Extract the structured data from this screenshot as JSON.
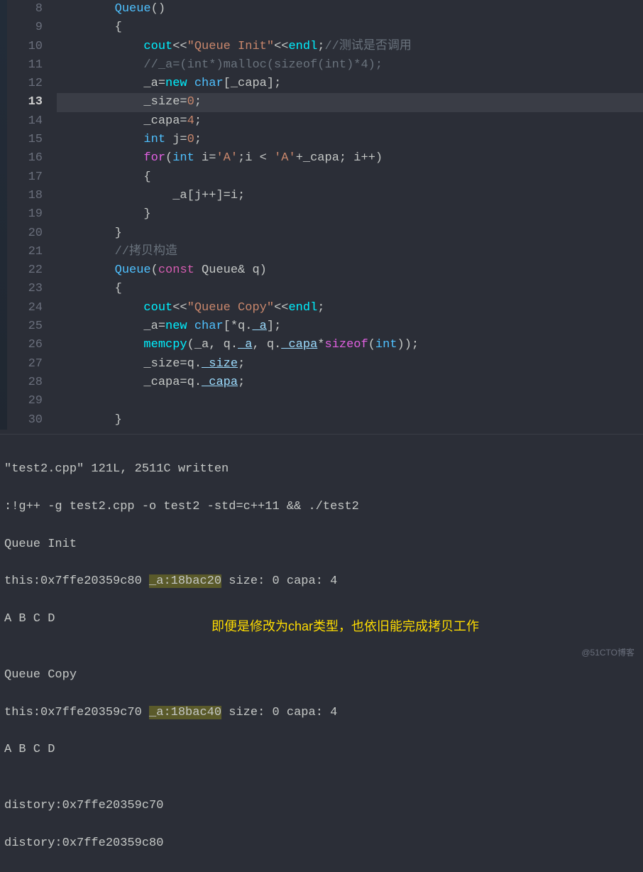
{
  "line_numbers": [
    "8",
    "9",
    "10",
    "11",
    "12",
    "13",
    "14",
    "15",
    "16",
    "17",
    "18",
    "19",
    "20",
    "21",
    "22",
    "23",
    "24",
    "25",
    "26",
    "27",
    "28",
    "29",
    "30"
  ],
  "current_line_index": 5,
  "code": {
    "l8": {
      "indent": "        ",
      "t1": "Queue",
      "t2": "()"
    },
    "l9": {
      "indent": "        ",
      "t1": "{"
    },
    "l10": {
      "indent": "            ",
      "t1": "cout",
      "t2": "<<",
      "t3": "\"Queue Init\"",
      "t4": "<<",
      "t5": "endl",
      "t6": ";",
      "t7": "//测试是否调用"
    },
    "l11": {
      "indent": "            ",
      "t1": "//_a=(int*)malloc(sizeof(int)*4);"
    },
    "l12": {
      "indent": "            ",
      "t1": "_a=",
      "t2": "new",
      "t3": " ",
      "t4": "char",
      "t5": "[_capa];"
    },
    "l13": {
      "indent": "            ",
      "t1": "_size=",
      "t2": "0",
      "t3": ";"
    },
    "l14": {
      "indent": "            ",
      "t1": "_capa=",
      "t2": "4",
      "t3": ";"
    },
    "l15": {
      "indent": "            ",
      "t1": "int",
      "t2": " j=",
      "t3": "0",
      "t4": ";"
    },
    "l16": {
      "indent": "            ",
      "t1": "for",
      "t2": "(",
      "t3": "int",
      "t4": " i=",
      "t5": "'A'",
      "t6": ";i < ",
      "t7": "'A'",
      "t8": "+_capa; i++)"
    },
    "l17": {
      "indent": "            ",
      "t1": "{"
    },
    "l18": {
      "indent": "                ",
      "t1": "_a[j++]=i;"
    },
    "l19": {
      "indent": "            ",
      "t1": "}"
    },
    "l20": {
      "indent": "        ",
      "t1": "}"
    },
    "l21": {
      "indent": "        ",
      "t1": "//拷贝构造"
    },
    "l22": {
      "indent": "        ",
      "t1": "Queue",
      "t2": "(",
      "t3": "const",
      "t4": " Queue& q)"
    },
    "l23": {
      "indent": "        ",
      "t1": "{"
    },
    "l24": {
      "indent": "            ",
      "t1": "cout",
      "t2": "<<",
      "t3": "\"Queue Copy\"",
      "t4": "<<",
      "t5": "endl",
      "t6": ";"
    },
    "l25": {
      "indent": "            ",
      "t1": "_a=",
      "t2": "new",
      "t3": " ",
      "t4": "char",
      "t5": "[*q.",
      "t6": "_a",
      "t7": "];"
    },
    "l26": {
      "indent": "            ",
      "t1": "memcpy",
      "t2": "(_a, q.",
      "t3": "_a",
      "t4": ", q.",
      "t5": "_capa",
      "t6": "*",
      "t7": "sizeof",
      "t8": "(",
      "t9": "int",
      "t10": "));"
    },
    "l27": {
      "indent": "            ",
      "t1": "_size=q.",
      "t2": "_size",
      "t3": ";"
    },
    "l28": {
      "indent": "            ",
      "t1": "_capa=q.",
      "t2": "_capa",
      "t3": ";"
    },
    "l29": {
      "indent": ""
    },
    "l30": {
      "indent": "        ",
      "t1": "}"
    }
  },
  "terminal": {
    "l1": "\"test2.cpp\" 121L, 2511C written",
    "l2": ":!g++ -g test2.cpp -o test2 -std=c++11 && ./test2",
    "l3": "Queue Init",
    "l4a": "this:0x7ffe20359c80 ",
    "l4b": "_a:18bac20",
    "l4c": " size: 0 capa: 4",
    "l5": "A B C D",
    "l6": "",
    "l7": "Queue Copy",
    "l8a": "this:0x7ffe20359c70 ",
    "l8b": "_a:18bac40",
    "l8c": " size: 0 capa: 4",
    "l9": "A B C D",
    "l10": "",
    "l11": "distory:0x7ffe20359c70",
    "l12": "distory:0x7ffe20359c80"
  },
  "annotation": "即便是修改为char类型，也依旧能完成拷贝工作",
  "watermark": "@51CTO博客"
}
